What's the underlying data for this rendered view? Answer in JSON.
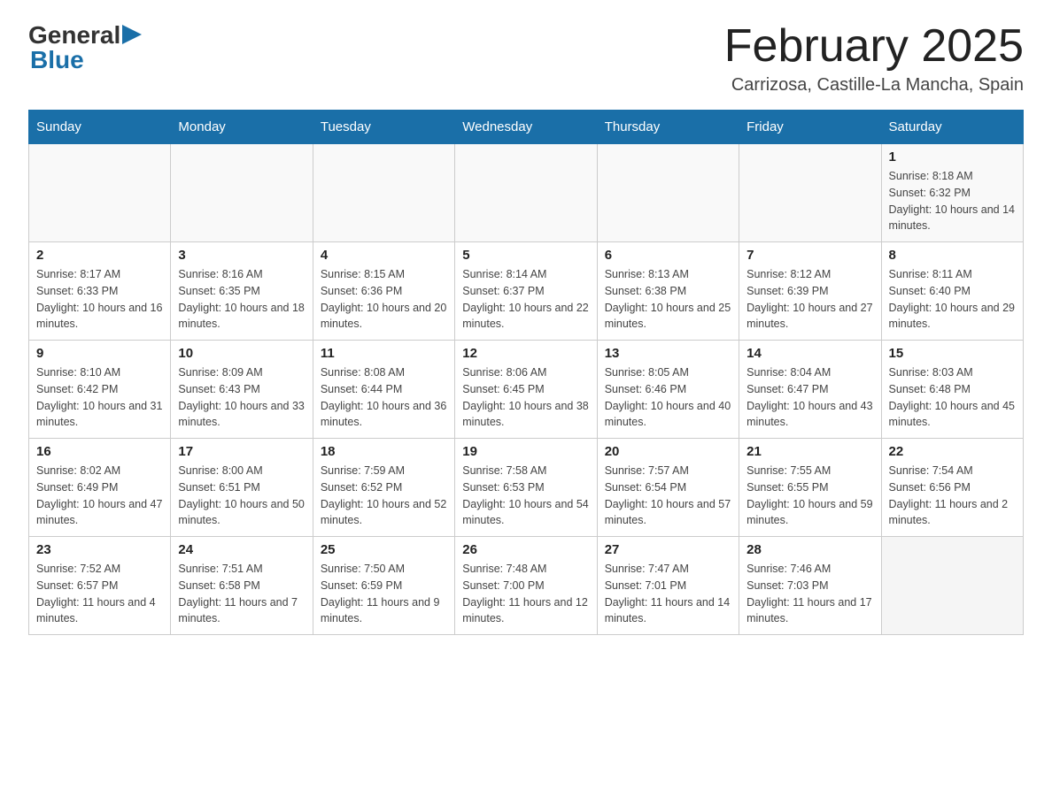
{
  "header": {
    "title": "February 2025",
    "subtitle": "Carrizosa, Castille-La Mancha, Spain",
    "logo_general": "General",
    "logo_blue": "Blue"
  },
  "weekdays": [
    "Sunday",
    "Monday",
    "Tuesday",
    "Wednesday",
    "Thursday",
    "Friday",
    "Saturday"
  ],
  "weeks": [
    [
      {
        "day": "",
        "info": ""
      },
      {
        "day": "",
        "info": ""
      },
      {
        "day": "",
        "info": ""
      },
      {
        "day": "",
        "info": ""
      },
      {
        "day": "",
        "info": ""
      },
      {
        "day": "",
        "info": ""
      },
      {
        "day": "1",
        "info": "Sunrise: 8:18 AM\nSunset: 6:32 PM\nDaylight: 10 hours and 14 minutes."
      }
    ],
    [
      {
        "day": "2",
        "info": "Sunrise: 8:17 AM\nSunset: 6:33 PM\nDaylight: 10 hours and 16 minutes."
      },
      {
        "day": "3",
        "info": "Sunrise: 8:16 AM\nSunset: 6:35 PM\nDaylight: 10 hours and 18 minutes."
      },
      {
        "day": "4",
        "info": "Sunrise: 8:15 AM\nSunset: 6:36 PM\nDaylight: 10 hours and 20 minutes."
      },
      {
        "day": "5",
        "info": "Sunrise: 8:14 AM\nSunset: 6:37 PM\nDaylight: 10 hours and 22 minutes."
      },
      {
        "day": "6",
        "info": "Sunrise: 8:13 AM\nSunset: 6:38 PM\nDaylight: 10 hours and 25 minutes."
      },
      {
        "day": "7",
        "info": "Sunrise: 8:12 AM\nSunset: 6:39 PM\nDaylight: 10 hours and 27 minutes."
      },
      {
        "day": "8",
        "info": "Sunrise: 8:11 AM\nSunset: 6:40 PM\nDaylight: 10 hours and 29 minutes."
      }
    ],
    [
      {
        "day": "9",
        "info": "Sunrise: 8:10 AM\nSunset: 6:42 PM\nDaylight: 10 hours and 31 minutes."
      },
      {
        "day": "10",
        "info": "Sunrise: 8:09 AM\nSunset: 6:43 PM\nDaylight: 10 hours and 33 minutes."
      },
      {
        "day": "11",
        "info": "Sunrise: 8:08 AM\nSunset: 6:44 PM\nDaylight: 10 hours and 36 minutes."
      },
      {
        "day": "12",
        "info": "Sunrise: 8:06 AM\nSunset: 6:45 PM\nDaylight: 10 hours and 38 minutes."
      },
      {
        "day": "13",
        "info": "Sunrise: 8:05 AM\nSunset: 6:46 PM\nDaylight: 10 hours and 40 minutes."
      },
      {
        "day": "14",
        "info": "Sunrise: 8:04 AM\nSunset: 6:47 PM\nDaylight: 10 hours and 43 minutes."
      },
      {
        "day": "15",
        "info": "Sunrise: 8:03 AM\nSunset: 6:48 PM\nDaylight: 10 hours and 45 minutes."
      }
    ],
    [
      {
        "day": "16",
        "info": "Sunrise: 8:02 AM\nSunset: 6:49 PM\nDaylight: 10 hours and 47 minutes."
      },
      {
        "day": "17",
        "info": "Sunrise: 8:00 AM\nSunset: 6:51 PM\nDaylight: 10 hours and 50 minutes."
      },
      {
        "day": "18",
        "info": "Sunrise: 7:59 AM\nSunset: 6:52 PM\nDaylight: 10 hours and 52 minutes."
      },
      {
        "day": "19",
        "info": "Sunrise: 7:58 AM\nSunset: 6:53 PM\nDaylight: 10 hours and 54 minutes."
      },
      {
        "day": "20",
        "info": "Sunrise: 7:57 AM\nSunset: 6:54 PM\nDaylight: 10 hours and 57 minutes."
      },
      {
        "day": "21",
        "info": "Sunrise: 7:55 AM\nSunset: 6:55 PM\nDaylight: 10 hours and 59 minutes."
      },
      {
        "day": "22",
        "info": "Sunrise: 7:54 AM\nSunset: 6:56 PM\nDaylight: 11 hours and 2 minutes."
      }
    ],
    [
      {
        "day": "23",
        "info": "Sunrise: 7:52 AM\nSunset: 6:57 PM\nDaylight: 11 hours and 4 minutes."
      },
      {
        "day": "24",
        "info": "Sunrise: 7:51 AM\nSunset: 6:58 PM\nDaylight: 11 hours and 7 minutes."
      },
      {
        "day": "25",
        "info": "Sunrise: 7:50 AM\nSunset: 6:59 PM\nDaylight: 11 hours and 9 minutes."
      },
      {
        "day": "26",
        "info": "Sunrise: 7:48 AM\nSunset: 7:00 PM\nDaylight: 11 hours and 12 minutes."
      },
      {
        "day": "27",
        "info": "Sunrise: 7:47 AM\nSunset: 7:01 PM\nDaylight: 11 hours and 14 minutes."
      },
      {
        "day": "28",
        "info": "Sunrise: 7:46 AM\nSunset: 7:03 PM\nDaylight: 11 hours and 17 minutes."
      },
      {
        "day": "",
        "info": ""
      }
    ]
  ]
}
